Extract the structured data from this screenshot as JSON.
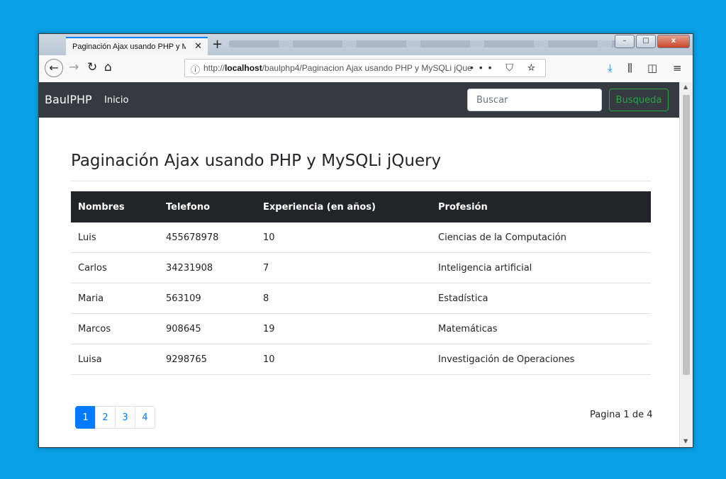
{
  "browser": {
    "tab_title": "Paginación Ajax usando PHP y MyS",
    "tab_close": "✕",
    "new_tab": "+",
    "url_prefix": "http://",
    "url_host": "localhost",
    "url_path": "/baulphp4/Paginacion Ajax usando PHP y MySQLi jQue",
    "url_actions": "••• ⛉ ☆",
    "window_buttons": [
      "–",
      "□",
      "x"
    ]
  },
  "navbar": {
    "brand": "BaulPHP",
    "link": "Inicio",
    "search_placeholder": "Buscar",
    "search_button": "Busqueda"
  },
  "page": {
    "title": "Paginación Ajax usando PHP y MySQLi jQuery"
  },
  "table": {
    "headers": [
      "Nombres",
      "Telefono",
      "Experiencia (en años)",
      "Profesión"
    ],
    "rows": [
      [
        "Luis",
        "455678978",
        "10",
        "Ciencias de la Computación"
      ],
      [
        "Carlos",
        "34231908",
        "7",
        "Inteligencia artificial"
      ],
      [
        "Maria",
        "563109",
        "8",
        "Estadística"
      ],
      [
        "Marcos",
        "908645",
        "19",
        "Matemáticas"
      ],
      [
        "Luisa",
        "9298765",
        "10",
        "Investigación de Operaciones"
      ]
    ]
  },
  "pagination": {
    "pages": [
      "1",
      "2",
      "3",
      "4"
    ],
    "active": "1",
    "info": "Pagina 1 de 4"
  },
  "colors": {
    "background": "#0aa0e6",
    "navbar": "#343a40",
    "table_header": "#212529",
    "primary": "#007bff",
    "success": "#28a745"
  }
}
